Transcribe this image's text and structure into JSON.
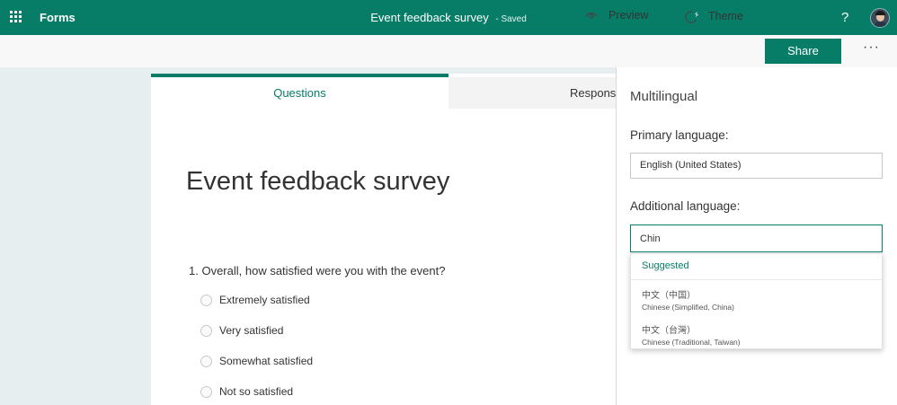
{
  "header": {
    "app_name": "Forms",
    "doc_title": "Event feedback survey",
    "status": "Saved",
    "help_label": "?"
  },
  "toolbar": {
    "preview_label": "Preview",
    "theme_label": "Theme",
    "share_label": "Share",
    "more_label": "···"
  },
  "tabs": {
    "questions": "Questions",
    "responses": "Responses"
  },
  "form": {
    "title": "Event feedback survey",
    "question_1": "1. Overall, how satisfied were you with the event?",
    "options": [
      "Extremely satisfied",
      "Very satisfied",
      "Somewhat satisfied",
      "Not so satisfied"
    ]
  },
  "multilingual": {
    "title": "Multilingual",
    "primary_label": "Primary language:",
    "primary_value": "English (United States)",
    "additional_label": "Additional language:",
    "additional_value": "Chin",
    "suggested_label": "Suggested",
    "suggestions": [
      {
        "native": "中文（中国）",
        "english": "Chinese (Simplified, China)"
      },
      {
        "native": "中文（台灣）",
        "english": "Chinese (Traditional, Taiwan)"
      }
    ]
  },
  "colors": {
    "brand": "#077d68",
    "background": "#e6eef0"
  }
}
